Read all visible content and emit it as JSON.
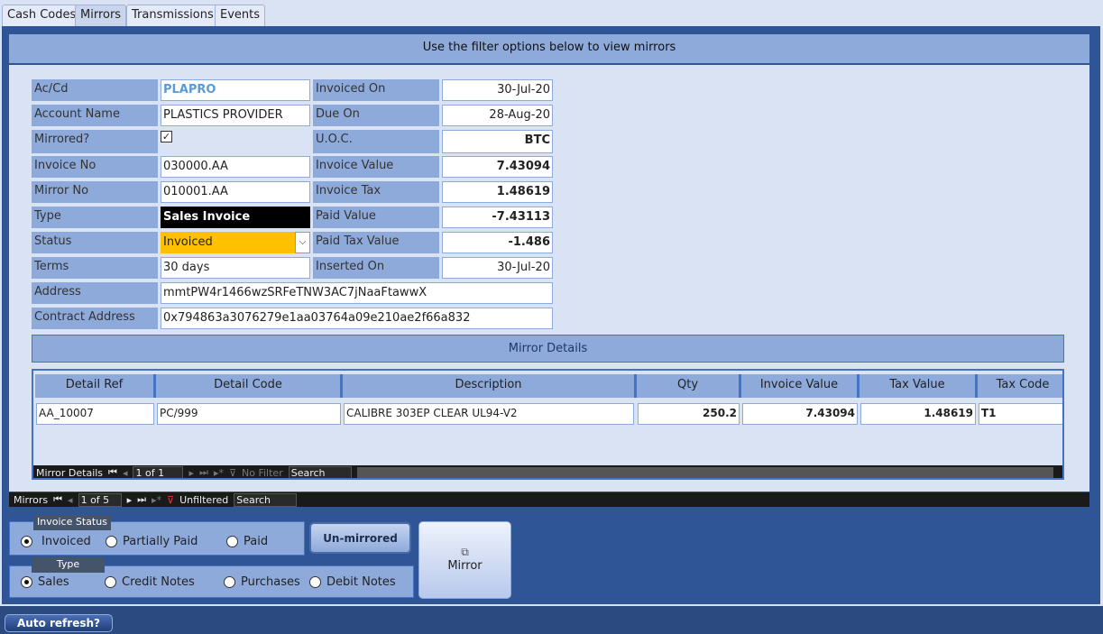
{
  "tabs": [
    "Cash Codes",
    "Mirrors",
    "Transmissions",
    "Events"
  ],
  "header": "Use the filter options below to view mirrors",
  "form": {
    "ac_cd_label": "Ac/Cd",
    "ac_cd": "PLAPRO",
    "account_name_label": "Account Name",
    "account_name": "PLASTICS PROVIDER",
    "mirrored_label": "Mirrored?",
    "mirrored": true,
    "invoice_no_label": "Invoice No",
    "invoice_no": "030000.AA",
    "mirror_no_label": "Mirror No",
    "mirror_no": "010001.AA",
    "type_label": "Type",
    "type": "Sales Invoice",
    "status_label": "Status",
    "status": "Invoiced",
    "terms_label": "Terms",
    "terms": "30 days",
    "address_label": "Address",
    "address": "mmtPW4r1466wzSRFeTNW3AC7jNaaFtawwX",
    "contract_address_label": "Contract Address",
    "contract_address": "0x794863a3076279e1aa03764a09e210ae2f66a832",
    "invoiced_on_label": "Invoiced On",
    "invoiced_on": "30-Jul-20",
    "due_on_label": "Due On",
    "due_on": "28-Aug-20",
    "uoc_label": "U.O.C.",
    "uoc": "BTC",
    "invoice_value_label": "Invoice Value",
    "invoice_value": "7.43094",
    "invoice_tax_label": "Invoice Tax",
    "invoice_tax": "1.48619",
    "paid_value_label": "Paid Value",
    "paid_value": "-7.43113",
    "paid_tax_value_label": "Paid Tax Value",
    "paid_tax_value": "-1.486",
    "inserted_on_label": "Inserted On",
    "inserted_on": "30-Jul-20"
  },
  "details": {
    "title": "Mirror Details",
    "columns": [
      "Detail Ref",
      "Detail Code",
      "Description",
      "Qty",
      "Invoice Value",
      "Tax Value",
      "Tax Code"
    ],
    "rows": [
      [
        "AA_10007",
        "PC/999",
        "CALIBRE 303EP CLEAR UL94-V2",
        "250.2",
        "7.43094",
        "1.48619",
        "T1"
      ]
    ],
    "nav": {
      "label": "Mirror Details",
      "record": "1 of 1",
      "filter": "No Filter",
      "search": "Search"
    }
  },
  "mirrors_nav": {
    "label": "Mirrors",
    "record": "1 of 5",
    "filter": "Unfiltered",
    "search": "Search"
  },
  "invoice_status": {
    "caption": "Invoice Status",
    "options": [
      "Invoiced",
      "Partially Paid",
      "Paid"
    ],
    "selected": "Invoiced"
  },
  "type_filter": {
    "caption": "Type",
    "options": [
      "Sales",
      "Credit Notes",
      "Purchases",
      "Debit Notes"
    ],
    "selected": "Sales"
  },
  "unmirrored_button": "Un-mirrored",
  "mirror_button": "Mirror",
  "auto_refresh_button": "Auto refresh?",
  "colors": {
    "frame": "#2f5597",
    "label_bg": "#8eaadb",
    "type_bg": "#000000",
    "status_bg": "#ffc000",
    "accent_text": "#5b9bd5"
  }
}
